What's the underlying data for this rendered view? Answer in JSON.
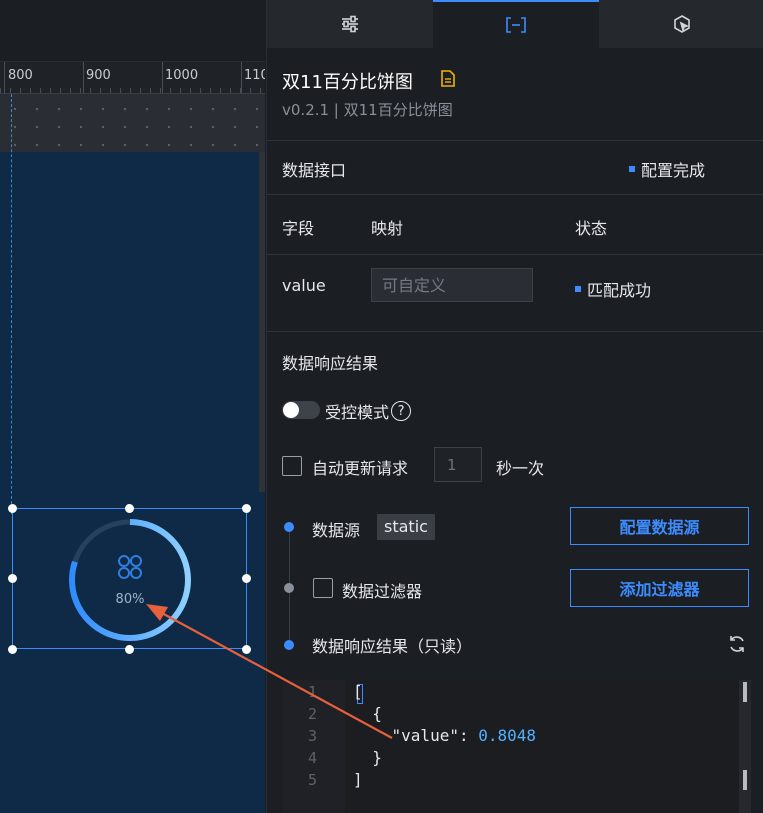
{
  "canvas": {
    "ruler_labels": [
      "800",
      "900",
      "1000",
      "110"
    ],
    "widget": {
      "percent_text": "80%",
      "progress": 0.8
    }
  },
  "panel": {
    "tabs": [
      {
        "icon": "sliders-icon",
        "active": false
      },
      {
        "icon": "bracket-data-icon",
        "active": true
      },
      {
        "icon": "interaction-icon",
        "active": false
      }
    ],
    "title": "双11百分比饼图",
    "subtitle": "v0.2.1 | 双11百分比饼图",
    "data_interface": {
      "heading": "数据接口",
      "status": "配置完成",
      "columns": {
        "field": "字段",
        "mapping": "映射",
        "status": "状态"
      },
      "rows": [
        {
          "field": "value",
          "mapping_placeholder": "可自定义",
          "status": "匹配成功"
        }
      ]
    },
    "response": {
      "heading": "数据响应结果",
      "controlled_mode_label": "受控模式",
      "auto_update_label": "自动更新请求",
      "interval_value": "1",
      "interval_suffix": "秒一次",
      "steps": {
        "source_label": "数据源",
        "source_tag": "static",
        "config_source_button": "配置数据源",
        "filter_label": "数据过滤器",
        "add_filter_button": "添加过滤器",
        "result_label": "数据响应结果（只读）"
      },
      "code_lines": [
        "[",
        "  {",
        "    \"value\": ",
        "  }",
        "]"
      ],
      "code_value": "0.8048",
      "line_numbers": [
        "1",
        "2",
        "3",
        "4",
        "5"
      ]
    }
  },
  "colors": {
    "accent": "#3c8cff",
    "canvas_bg": "#0e2a47",
    "panel_bg": "#1b1e23",
    "arrow": "#e8603c"
  }
}
